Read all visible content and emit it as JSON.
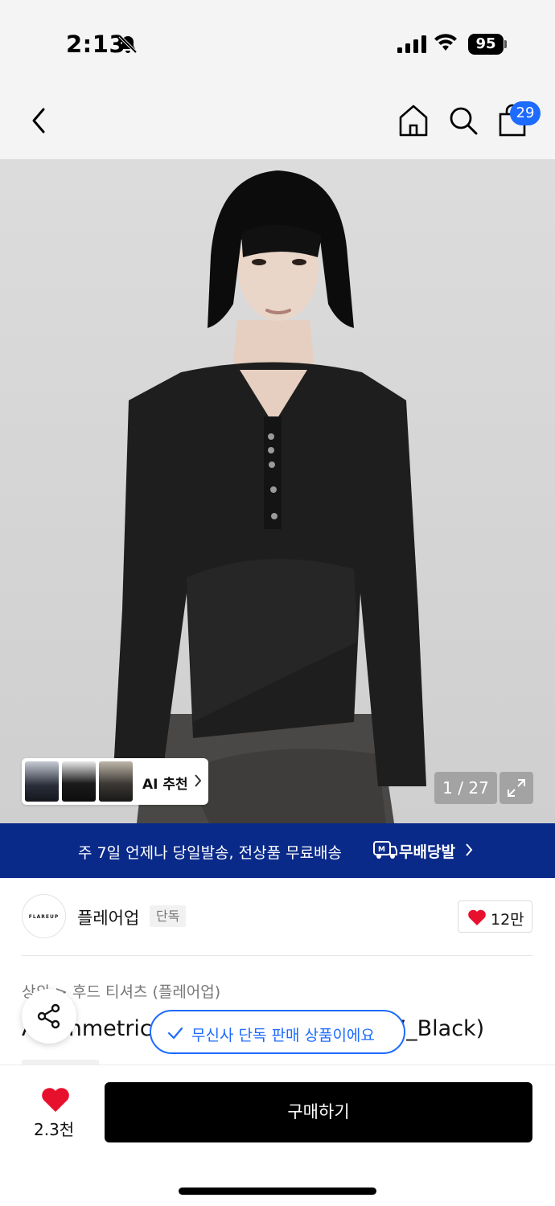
{
  "status_bar": {
    "time": "2:13",
    "battery": "95"
  },
  "nav": {
    "cart_count": "29"
  },
  "hero": {
    "ai_label": "AI 추천",
    "counter": "1 / 27"
  },
  "banner": {
    "text": "주 7일 언제나 당일발송, 전상품 무료배송",
    "brand": "무배당발"
  },
  "brand": {
    "logo_text": "FLAREUP",
    "name": "플레어업",
    "tag": "단독",
    "likes": "12만"
  },
  "product": {
    "breadcrumb": "상의 > 후드 티셔츠 (플레어업)",
    "title": "Asymmetric Henley Hoodie (FL-187_Black)"
  },
  "toast": {
    "text": "무신사 단독 판매 상품이에요"
  },
  "bottom_bar": {
    "wish_count": "2.3천",
    "buy_label": "구매하기"
  },
  "colors": {
    "accent": "#1d6bff",
    "banner": "#0a2a8a",
    "heart": "#e8112d"
  }
}
